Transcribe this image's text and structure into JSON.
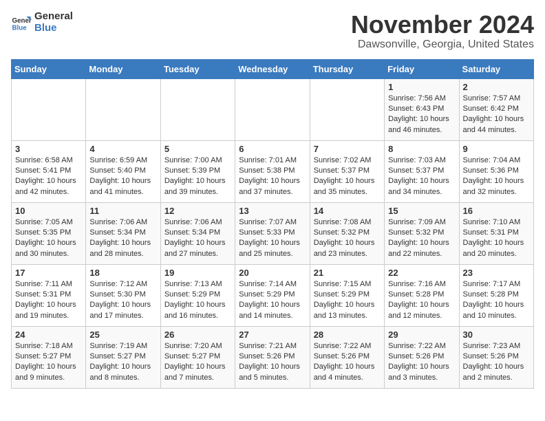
{
  "header": {
    "logo_general": "General",
    "logo_blue": "Blue",
    "month": "November 2024",
    "location": "Dawsonville, Georgia, United States"
  },
  "weekdays": [
    "Sunday",
    "Monday",
    "Tuesday",
    "Wednesday",
    "Thursday",
    "Friday",
    "Saturday"
  ],
  "weeks": [
    [
      {
        "day": "",
        "info": ""
      },
      {
        "day": "",
        "info": ""
      },
      {
        "day": "",
        "info": ""
      },
      {
        "day": "",
        "info": ""
      },
      {
        "day": "",
        "info": ""
      },
      {
        "day": "1",
        "info": "Sunrise: 7:56 AM\nSunset: 6:43 PM\nDaylight: 10 hours\nand 46 minutes."
      },
      {
        "day": "2",
        "info": "Sunrise: 7:57 AM\nSunset: 6:42 PM\nDaylight: 10 hours\nand 44 minutes."
      }
    ],
    [
      {
        "day": "3",
        "info": "Sunrise: 6:58 AM\nSunset: 5:41 PM\nDaylight: 10 hours\nand 42 minutes."
      },
      {
        "day": "4",
        "info": "Sunrise: 6:59 AM\nSunset: 5:40 PM\nDaylight: 10 hours\nand 41 minutes."
      },
      {
        "day": "5",
        "info": "Sunrise: 7:00 AM\nSunset: 5:39 PM\nDaylight: 10 hours\nand 39 minutes."
      },
      {
        "day": "6",
        "info": "Sunrise: 7:01 AM\nSunset: 5:38 PM\nDaylight: 10 hours\nand 37 minutes."
      },
      {
        "day": "7",
        "info": "Sunrise: 7:02 AM\nSunset: 5:37 PM\nDaylight: 10 hours\nand 35 minutes."
      },
      {
        "day": "8",
        "info": "Sunrise: 7:03 AM\nSunset: 5:37 PM\nDaylight: 10 hours\nand 34 minutes."
      },
      {
        "day": "9",
        "info": "Sunrise: 7:04 AM\nSunset: 5:36 PM\nDaylight: 10 hours\nand 32 minutes."
      }
    ],
    [
      {
        "day": "10",
        "info": "Sunrise: 7:05 AM\nSunset: 5:35 PM\nDaylight: 10 hours\nand 30 minutes."
      },
      {
        "day": "11",
        "info": "Sunrise: 7:06 AM\nSunset: 5:34 PM\nDaylight: 10 hours\nand 28 minutes."
      },
      {
        "day": "12",
        "info": "Sunrise: 7:06 AM\nSunset: 5:34 PM\nDaylight: 10 hours\nand 27 minutes."
      },
      {
        "day": "13",
        "info": "Sunrise: 7:07 AM\nSunset: 5:33 PM\nDaylight: 10 hours\nand 25 minutes."
      },
      {
        "day": "14",
        "info": "Sunrise: 7:08 AM\nSunset: 5:32 PM\nDaylight: 10 hours\nand 23 minutes."
      },
      {
        "day": "15",
        "info": "Sunrise: 7:09 AM\nSunset: 5:32 PM\nDaylight: 10 hours\nand 22 minutes."
      },
      {
        "day": "16",
        "info": "Sunrise: 7:10 AM\nSunset: 5:31 PM\nDaylight: 10 hours\nand 20 minutes."
      }
    ],
    [
      {
        "day": "17",
        "info": "Sunrise: 7:11 AM\nSunset: 5:31 PM\nDaylight: 10 hours\nand 19 minutes."
      },
      {
        "day": "18",
        "info": "Sunrise: 7:12 AM\nSunset: 5:30 PM\nDaylight: 10 hours\nand 17 minutes."
      },
      {
        "day": "19",
        "info": "Sunrise: 7:13 AM\nSunset: 5:29 PM\nDaylight: 10 hours\nand 16 minutes."
      },
      {
        "day": "20",
        "info": "Sunrise: 7:14 AM\nSunset: 5:29 PM\nDaylight: 10 hours\nand 14 minutes."
      },
      {
        "day": "21",
        "info": "Sunrise: 7:15 AM\nSunset: 5:29 PM\nDaylight: 10 hours\nand 13 minutes."
      },
      {
        "day": "22",
        "info": "Sunrise: 7:16 AM\nSunset: 5:28 PM\nDaylight: 10 hours\nand 12 minutes."
      },
      {
        "day": "23",
        "info": "Sunrise: 7:17 AM\nSunset: 5:28 PM\nDaylight: 10 hours\nand 10 minutes."
      }
    ],
    [
      {
        "day": "24",
        "info": "Sunrise: 7:18 AM\nSunset: 5:27 PM\nDaylight: 10 hours\nand 9 minutes."
      },
      {
        "day": "25",
        "info": "Sunrise: 7:19 AM\nSunset: 5:27 PM\nDaylight: 10 hours\nand 8 minutes."
      },
      {
        "day": "26",
        "info": "Sunrise: 7:20 AM\nSunset: 5:27 PM\nDaylight: 10 hours\nand 7 minutes."
      },
      {
        "day": "27",
        "info": "Sunrise: 7:21 AM\nSunset: 5:26 PM\nDaylight: 10 hours\nand 5 minutes."
      },
      {
        "day": "28",
        "info": "Sunrise: 7:22 AM\nSunset: 5:26 PM\nDaylight: 10 hours\nand 4 minutes."
      },
      {
        "day": "29",
        "info": "Sunrise: 7:22 AM\nSunset: 5:26 PM\nDaylight: 10 hours\nand 3 minutes."
      },
      {
        "day": "30",
        "info": "Sunrise: 7:23 AM\nSunset: 5:26 PM\nDaylight: 10 hours\nand 2 minutes."
      }
    ]
  ]
}
